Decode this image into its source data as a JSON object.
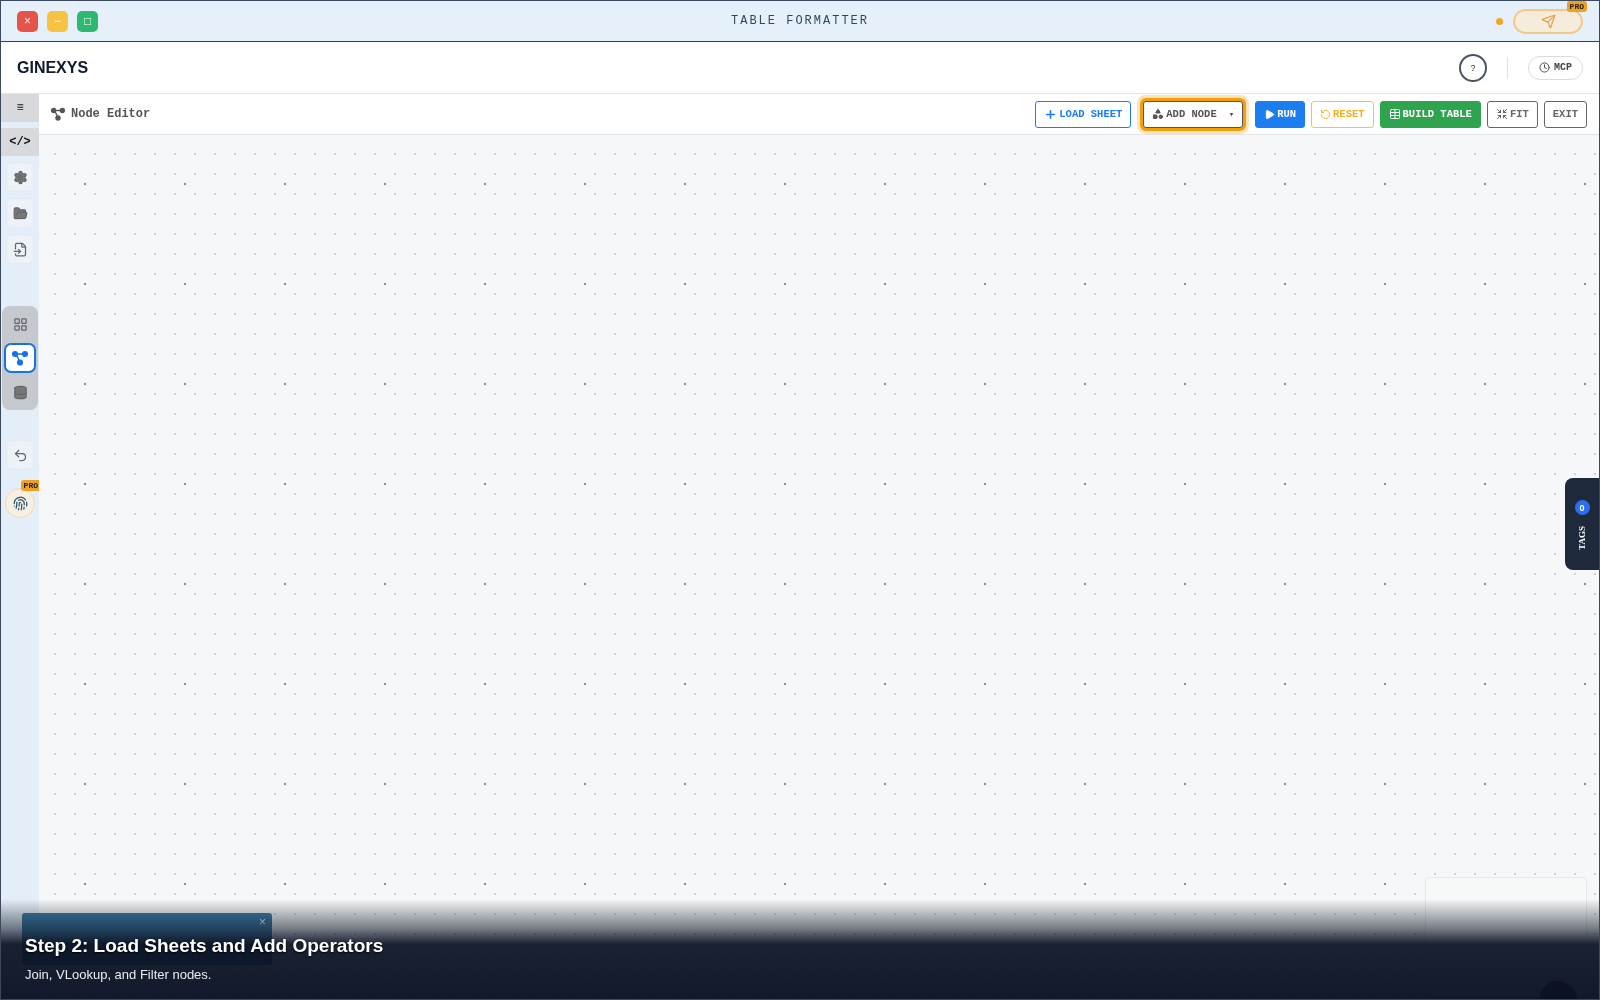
{
  "window": {
    "title": "TABLE FORMATTER",
    "controls": [
      {
        "kind": "close",
        "label": "×"
      },
      {
        "kind": "minimize",
        "label": "−"
      },
      {
        "kind": "maximize",
        "label": "□"
      }
    ],
    "send_badge": "PRO"
  },
  "header": {
    "brand": "GINEXYS",
    "help": "?",
    "mcp": "MCP"
  },
  "sidebar": {
    "top": [
      {
        "kind": "text",
        "label": "≡"
      },
      {
        "kind": "text",
        "label": "</>"
      },
      {
        "kind": "gear"
      },
      {
        "kind": "folder"
      },
      {
        "kind": "import"
      }
    ],
    "views": [
      {
        "kind": "table",
        "selected": false
      },
      {
        "kind": "nodes",
        "selected": true
      },
      {
        "kind": "database",
        "selected": false
      }
    ],
    "pro_badge": "PRO"
  },
  "toolbar": {
    "title": "Node Editor",
    "buttons": [
      {
        "kind": "load",
        "label": "LOAD SHEET",
        "highlighted": false
      },
      {
        "kind": "add",
        "label": "ADD NODE",
        "caret": "▾",
        "highlighted": true
      },
      {
        "kind": "run",
        "label": "RUN",
        "highlighted": false
      },
      {
        "kind": "reset",
        "label": "RESET",
        "highlighted": false
      },
      {
        "kind": "build",
        "label": "BUILD TABLE",
        "highlighted": false
      },
      {
        "kind": "fit",
        "label": "FIT",
        "highlighted": false
      },
      {
        "kind": "exit",
        "label": "EXIT",
        "highlighted": false
      }
    ]
  },
  "tags": {
    "count": "0",
    "label": "TAGS"
  },
  "toast": {
    "close": "×"
  },
  "caption": {
    "title": "Step 2: Load Sheets and Add Operators",
    "text": "Join, VLookup, and Filter nodes."
  }
}
